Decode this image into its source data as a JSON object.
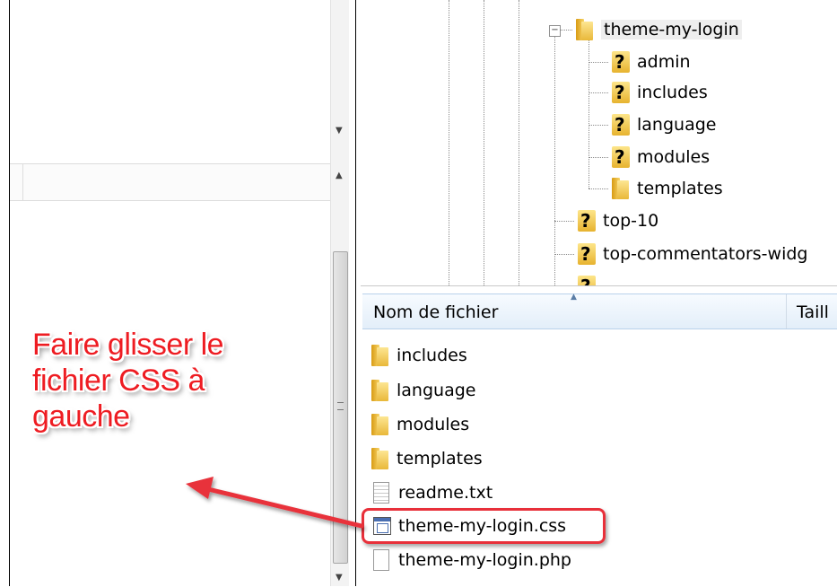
{
  "tree": {
    "root": {
      "label": "theme-my-login",
      "toggle": "⊟"
    },
    "children": [
      {
        "label": "admin",
        "icon": "question-folder-icon"
      },
      {
        "label": "includes",
        "icon": "question-folder-icon"
      },
      {
        "label": "language",
        "icon": "question-folder-icon"
      },
      {
        "label": "modules",
        "icon": "question-folder-icon"
      },
      {
        "label": "templates",
        "icon": "folder-icon"
      }
    ],
    "siblings": [
      {
        "label": "top-10",
        "icon": "question-folder-icon"
      },
      {
        "label": "top-commentators-widg",
        "icon": "question-folder-icon"
      }
    ]
  },
  "file_list": {
    "columns": [
      {
        "label": "Nom de fichier"
      },
      {
        "label": "Taill"
      }
    ],
    "rows": [
      {
        "name": "includes",
        "icon": "folder-icon"
      },
      {
        "name": "language",
        "icon": "folder-icon"
      },
      {
        "name": "modules",
        "icon": "folder-icon"
      },
      {
        "name": "templates",
        "icon": "folder-icon"
      },
      {
        "name": "readme.txt",
        "icon": "text-file-icon"
      },
      {
        "name": "theme-my-login.css",
        "icon": "css-file-icon",
        "highlighted": true
      },
      {
        "name": "theme-my-login.php",
        "icon": "blank-file-icon"
      }
    ]
  },
  "annotation": {
    "line1": "Faire glisser le",
    "line2": "fichier CSS à",
    "line3": "gauche",
    "color": "#ee1c22"
  },
  "colors": {
    "highlight_border": "#e8303a",
    "pane_border": "#000000",
    "header_bg": "#eaf3fb"
  }
}
